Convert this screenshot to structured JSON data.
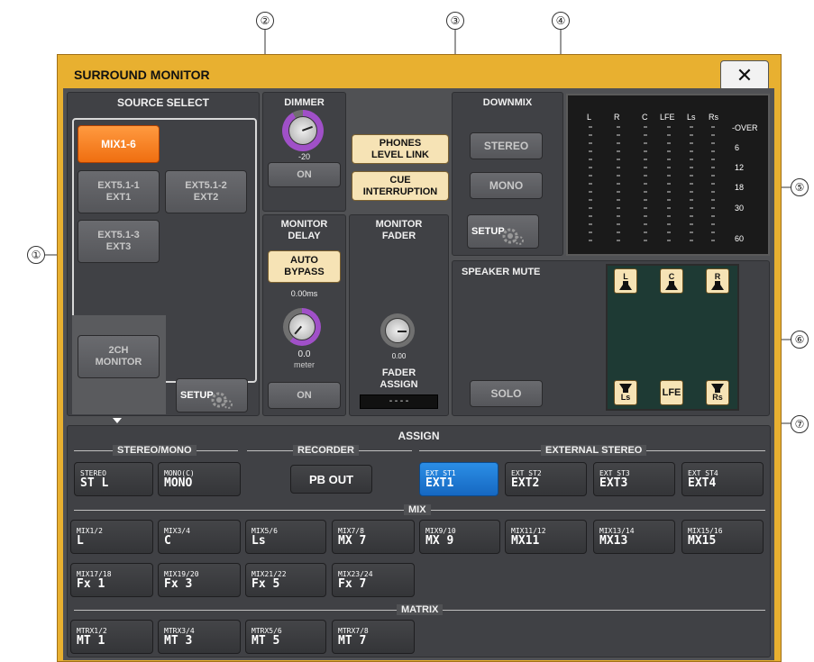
{
  "window": {
    "title": "SURROUND MONITOR",
    "close_glyph": "✕"
  },
  "callouts": [
    "①",
    "②",
    "③",
    "④",
    "⑤",
    "⑥",
    "⑦"
  ],
  "source_select": {
    "title": "SOURCE SELECT",
    "buttons": [
      "MIX1-6",
      "EXT5.1-1\nEXT1",
      "EXT5.1-2\nEXT2",
      "EXT5.1-3\nEXT3",
      "2CH\nMONITOR"
    ],
    "selected": "MIX1-6",
    "setup": "SETUP"
  },
  "dimmer": {
    "title": "DIMMER",
    "value": "-20",
    "on": "ON"
  },
  "links": {
    "phones": "PHONES\nLEVEL LINK",
    "cue": "CUE\nINTERRUPTION"
  },
  "monitor_delay": {
    "title": "MONITOR\nDELAY",
    "auto_bypass": "AUTO\nBYPASS",
    "time": "0.00ms",
    "value": "0.0",
    "unit": "meter",
    "on": "ON"
  },
  "monitor_fader": {
    "title": "MONITOR\nFADER",
    "value": "0.00",
    "assign_label": "FADER\nASSIGN",
    "assign_value": "----"
  },
  "downmix": {
    "title": "DOWNMIX",
    "stereo": "STEREO",
    "mono": "MONO",
    "setup": "SETUP"
  },
  "meter": {
    "channels": [
      "L",
      "R",
      "C",
      "LFE",
      "Ls",
      "Rs"
    ],
    "scale": [
      "-OVER",
      "6",
      "12",
      "18",
      "30",
      "60"
    ]
  },
  "speaker_mute": {
    "title": "SPEAKER MUTE",
    "top": [
      "L",
      "C",
      "R"
    ],
    "bottom": [
      "Ls",
      "LFE",
      "Rs"
    ],
    "solo": "SOLO"
  },
  "assign": {
    "title": "ASSIGN",
    "groups": {
      "stereo_mono": "STEREO/MONO",
      "recorder": "RECORDER",
      "external_stereo": "EXTERNAL STEREO",
      "mix": "MIX",
      "matrix": "MATRIX"
    },
    "stereo_mono": [
      {
        "s": "STEREO",
        "m": "ST L"
      },
      {
        "s": "MONO(C)",
        "m": "MONO"
      }
    ],
    "recorder": "PB OUT",
    "external": [
      {
        "s": "EXT ST1",
        "m": "EXT1"
      },
      {
        "s": "EXT ST2",
        "m": "EXT2"
      },
      {
        "s": "EXT ST3",
        "m": "EXT3"
      },
      {
        "s": "EXT ST4",
        "m": "EXT4"
      }
    ],
    "mix": [
      {
        "s": "MIX1/2",
        "m": "L"
      },
      {
        "s": "MIX3/4",
        "m": "C"
      },
      {
        "s": "MIX5/6",
        "m": "Ls"
      },
      {
        "s": "MIX7/8",
        "m": "MX 7"
      },
      {
        "s": "MIX9/10",
        "m": "MX 9"
      },
      {
        "s": "MIX11/12",
        "m": "MX11"
      },
      {
        "s": "MIX13/14",
        "m": "MX13"
      },
      {
        "s": "MIX15/16",
        "m": "MX15"
      },
      {
        "s": "MIX17/18",
        "m": "Fx 1"
      },
      {
        "s": "MIX19/20",
        "m": "Fx 3"
      },
      {
        "s": "MIX21/22",
        "m": "Fx 5"
      },
      {
        "s": "MIX23/24",
        "m": "Fx 7"
      }
    ],
    "matrix": [
      {
        "s": "MTRX1/2",
        "m": "MT 1"
      },
      {
        "s": "MTRX3/4",
        "m": "MT 3"
      },
      {
        "s": "MTRX5/6",
        "m": "MT 5"
      },
      {
        "s": "MTRX7/8",
        "m": "MT 7"
      }
    ]
  },
  "colors": {
    "title_bar": "#e8b030",
    "selected": "#ef6e10",
    "selected_ext": "#1f7ad6",
    "panel": "#404145"
  }
}
